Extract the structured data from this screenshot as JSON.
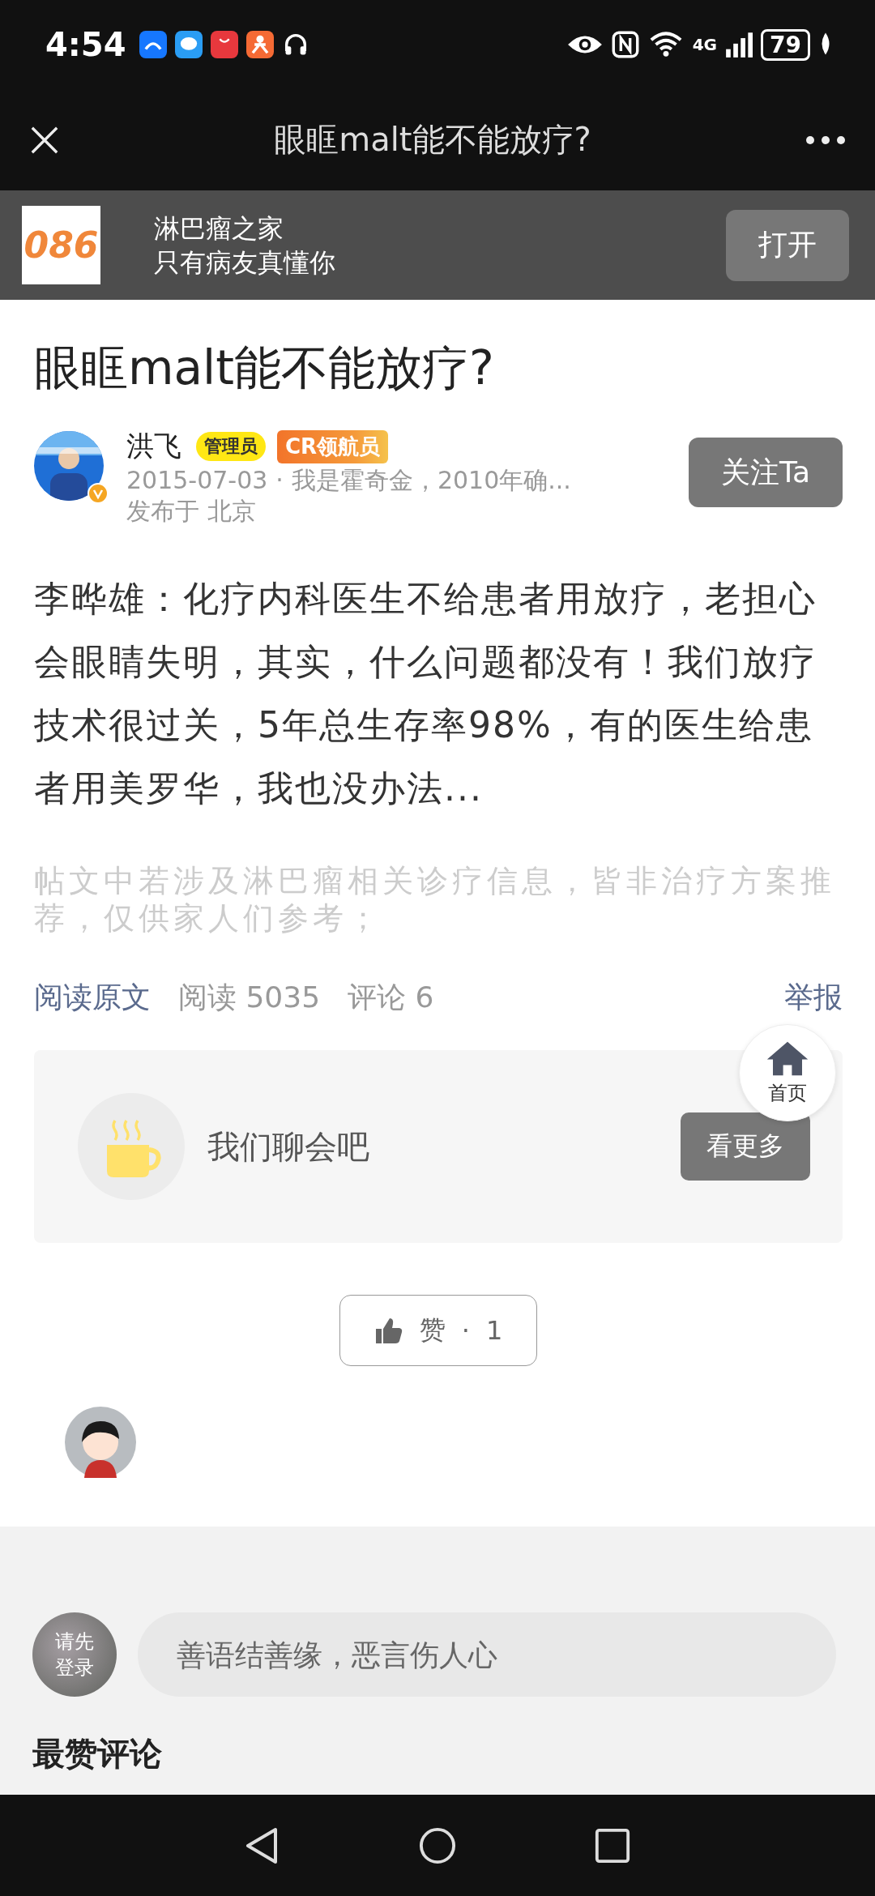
{
  "status_bar": {
    "time": "4:54",
    "network": "4G",
    "battery": "79"
  },
  "nav": {
    "title": "眼眶malt能不能放疗?"
  },
  "app_banner": {
    "logo_text": "086",
    "name": "淋巴瘤之家",
    "slogan": "只有病友真懂你",
    "button": "打开"
  },
  "post": {
    "title": "眼眶malt能不能放疗?",
    "author": {
      "name": "洪飞",
      "verified": true,
      "badges": [
        {
          "label": "管理员",
          "kind": "admin"
        },
        {
          "label": "CR领航员",
          "kind": "cr"
        }
      ],
      "date": "2015-07-03",
      "separator": "·",
      "bio": "我是霍奇金，2010年确...",
      "location": "发布于 北京"
    },
    "follow_button": "关注Ta",
    "body": "李晔雄：化疗内科医生不给患者用放疗，老担心会眼睛失明，其实，什么问题都没有！我们放疗技术很过关，5年总生存率98%，有的医生给患者用美罗华，我也没办法...",
    "disclaimer": "帖文中若涉及淋巴瘤相关诊疗信息，皆非治疗方案推荐，仅供家人们参考；",
    "read_original": "阅读原文",
    "reads": "阅读 5035",
    "comments": "评论 6",
    "report": "举报"
  },
  "home_button": {
    "label": "首页"
  },
  "chat_card": {
    "text": "我们聊会吧",
    "button": "看更多"
  },
  "like": {
    "label": "赞",
    "separator": "·",
    "count": "1"
  },
  "comment_bar": {
    "login": "请先登录",
    "placeholder": "善语结善缘，恶言伤人心"
  },
  "comments_heading": "最赞评论"
}
